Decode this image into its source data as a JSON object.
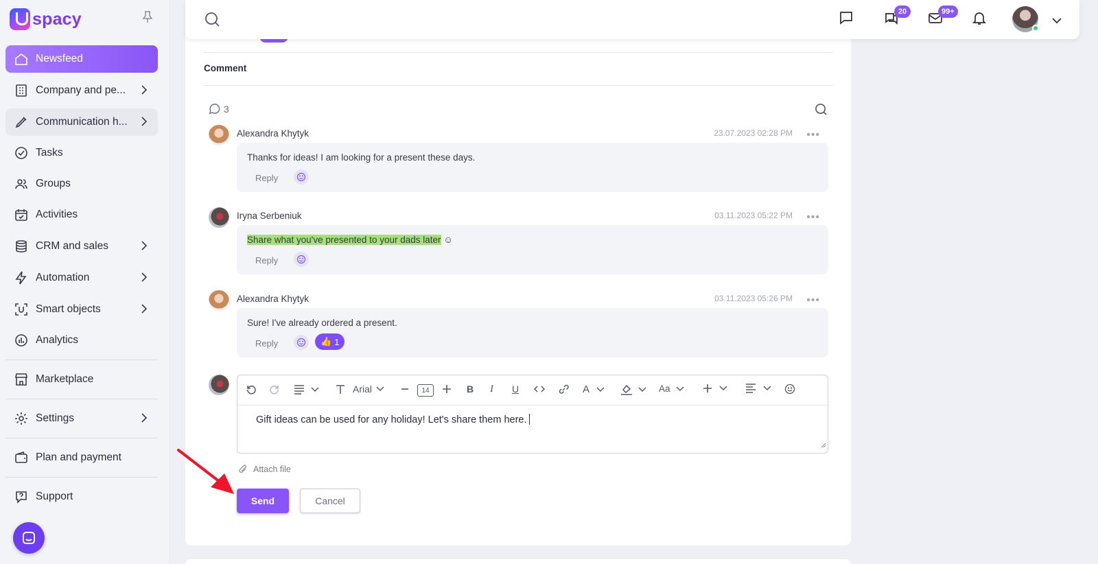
{
  "app": {
    "logo_text": "spacy"
  },
  "sidebar": {
    "items": [
      {
        "label": "Newsfeed",
        "icon": "home-icon"
      },
      {
        "label": "Company and pe...",
        "icon": "building-icon"
      },
      {
        "label": "Communication h...",
        "icon": "communication-icon"
      },
      {
        "label": "Tasks",
        "icon": "check-circle-icon"
      },
      {
        "label": "Groups",
        "icon": "users-icon"
      },
      {
        "label": "Activities",
        "icon": "calendar-icon"
      },
      {
        "label": "CRM and sales",
        "icon": "database-icon"
      },
      {
        "label": "Automation",
        "icon": "lightning-icon"
      },
      {
        "label": "Smart objects",
        "icon": "smart-object-icon"
      },
      {
        "label": "Analytics",
        "icon": "chart-icon"
      },
      {
        "label": "Marketplace",
        "icon": "store-icon"
      },
      {
        "label": "Settings",
        "icon": "gear-icon"
      },
      {
        "label": "Plan and payment",
        "icon": "wallet-icon"
      },
      {
        "label": "Support",
        "icon": "help-icon"
      }
    ]
  },
  "header": {
    "chat_badge": "20",
    "mail_badge": "99+"
  },
  "comments_section": {
    "title": "Comment",
    "count": "3",
    "items": [
      {
        "author": "Alexandra Khytyk",
        "date": "23.07.2023 02:28 PM",
        "text": "Thanks for ideas! I am looking for a present these days.",
        "reply": "Reply"
      },
      {
        "author": "Iryna Serbeniuk",
        "date": "03.11.2023 05:22 PM",
        "text_highlight": "Share what you've presented to your dads later",
        "text_rest": " ☺",
        "reply": "Reply"
      },
      {
        "author": "Alexandra Khytyk",
        "date": "03.11.2023 05:26 PM",
        "text": "Sure! I've already ordered a present.",
        "reply": "Reply",
        "reaction_emoji": "👍",
        "reaction_count": "1"
      }
    ]
  },
  "editor": {
    "font": "Arial",
    "font_size": "14",
    "text_case_label": "Aa",
    "content": "Gift ideas can be used for any holiday! Let's share them here.",
    "attach_label": "Attach file",
    "send_label": "Send",
    "cancel_label": "Cancel"
  },
  "colors": {
    "accent": "#8a55f6",
    "highlight": "#a6e07a",
    "arrow": "#f0152a"
  }
}
